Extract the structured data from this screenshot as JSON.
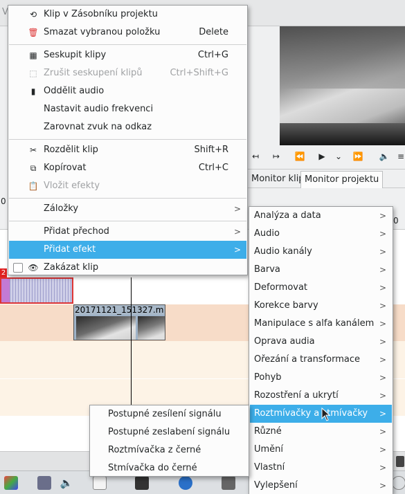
{
  "background": {
    "title_fragment": "V",
    "tabs": [
      "Monitor klipu",
      "Monitor projektu"
    ],
    "ruler": {
      "start": "0",
      "end": "0"
    },
    "clip_red_badge": "2",
    "clip_name": "20171121_151327.m"
  },
  "context_menu": {
    "items": [
      {
        "icon": "clip-bin-icon",
        "label": "Klip v Zásobníku projektu",
        "shortcut": ""
      },
      {
        "icon": "trash-icon",
        "label": "Smazat vybranou položku",
        "shortcut": "Delete"
      },
      {
        "icon": "group-icon",
        "label": "Seskupit klipy",
        "shortcut": "Ctrl+G"
      },
      {
        "icon": "ungroup-icon",
        "label": "Zrušit seskupení klipů",
        "shortcut": "Ctrl+Shift+G",
        "disabled": true
      },
      {
        "icon": "document-icon",
        "label": "Oddělit audio",
        "shortcut": ""
      },
      {
        "icon": "",
        "label": "Nastavit audio frekvenci",
        "shortcut": ""
      },
      {
        "icon": "",
        "label": "Zarovnat zvuk na odkaz",
        "shortcut": ""
      },
      {
        "icon": "scissors-icon",
        "label": "Rozdělit klip",
        "shortcut": "Shift+R"
      },
      {
        "icon": "copy-icon",
        "label": "Kopírovat",
        "shortcut": "Ctrl+C"
      },
      {
        "icon": "clipboard-icon",
        "label": "Vložit efekty",
        "shortcut": "",
        "disabled": true
      },
      {
        "icon": "",
        "label": "Záložky",
        "shortcut": "",
        "submenu": true
      },
      {
        "icon": "",
        "label": "Přidat přechod",
        "shortcut": "",
        "submenu": true
      },
      {
        "icon": "",
        "label": "Přidat efekt",
        "shortcut": "",
        "submenu": true,
        "highlighted": true
      },
      {
        "icon": "eye-icon",
        "label": "Zakázat klip",
        "shortcut": "",
        "checkbox": true
      }
    ]
  },
  "effects_submenu": {
    "items": [
      "Analýza a data",
      "Audio",
      "Audio kanály",
      "Barva",
      "Deformovat",
      "Korekce barvy",
      "Manipulace s alfa kanálem",
      "Oprava audia",
      "Ořezání a transformace",
      "Pohyb",
      "Rozostření a ukrytí",
      "Roztmívačky a stmívačky",
      "Různé",
      "Umění",
      "Vlastní",
      "Vylepšení"
    ],
    "highlighted": "Roztmívačky a stmívačky"
  },
  "fade_submenu": {
    "items": [
      "Postupné zesílení signálu",
      "Postupné zeslabení signálu",
      "Roztmívačka z černé",
      "Stmívačka do černé"
    ]
  },
  "colors": {
    "highlight": "#3daee9",
    "clip_border_red": "#dd3333"
  }
}
